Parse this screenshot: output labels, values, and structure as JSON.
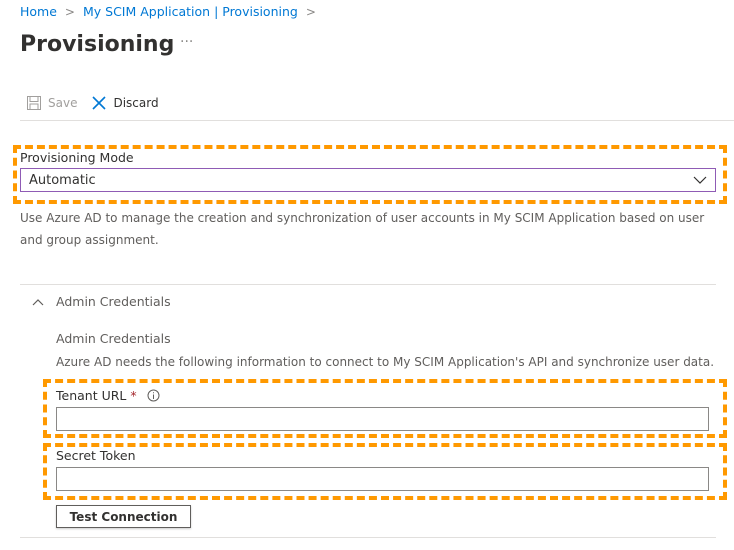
{
  "breadcrumb": {
    "items": [
      "Home",
      "My SCIM Application | Provisioning"
    ],
    "separator": ">"
  },
  "page": {
    "title": "Provisioning",
    "more": "···"
  },
  "toolbar": {
    "save_label": "Save",
    "discard_label": "Discard"
  },
  "provisioning_mode": {
    "label": "Provisioning Mode",
    "value": "Automatic",
    "description": "Use Azure AD to manage the creation and synchronization of user accounts in My SCIM Application based on user and group assignment."
  },
  "admin_credentials": {
    "section_title": "Admin Credentials",
    "subheading": "Admin Credentials",
    "description": "Azure AD needs the following information to connect to My SCIM Application's API and synchronize user data.",
    "tenant_url": {
      "label": "Tenant URL",
      "required": "*",
      "value": ""
    },
    "secret_token": {
      "label": "Secret Token",
      "value": ""
    },
    "test_button": "Test Connection"
  },
  "colors": {
    "highlight": "#ff9900",
    "link": "#0078d4",
    "focus_border": "#8f5bb5",
    "required": "#a4262c"
  }
}
